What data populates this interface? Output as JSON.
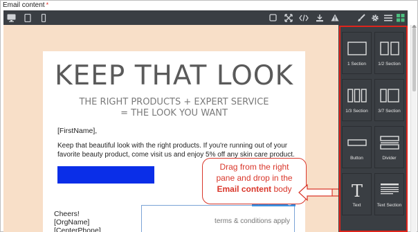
{
  "field": {
    "label": "Email content",
    "required_mark": "*"
  },
  "toolbar": {
    "left_icons": [
      "desktop-icon",
      "tablet-icon",
      "mobile-icon"
    ],
    "right_icons": [
      "square-icon",
      "fullscreen-icon",
      "code-icon",
      "download-icon",
      "warning-icon",
      "brush-icon",
      "gear-icon",
      "menu-icon",
      "blocks-icon"
    ],
    "active_icon": "blocks-icon",
    "accent_color": "#4cbf7f"
  },
  "email": {
    "headline": "KEEP THAT LOOK",
    "subhead_line1": "THE RIGHT PRODUCTS + EXPERT SERVICE",
    "subhead_line2": "= THE LOOK YOU WANT",
    "firstname": "[FirstName],",
    "body": "Keep that beautiful look with the right products. If you're running out of your favorite beauty product, come visit us and enjoy 5% off any skin care product.",
    "cta_color": "#0a2ee8",
    "signoff": [
      "Cheers!",
      "[OrgName]",
      "[CenterPhone]"
    ],
    "terms": "terms & conditions apply"
  },
  "callout": {
    "line1": "Drag from the right",
    "line2": "pane and drop in the",
    "bold": "Email content",
    "tail": " body"
  },
  "blocks": [
    {
      "label": "1 Section",
      "icon": "one-section-icon"
    },
    {
      "label": "1/2 Section",
      "icon": "half-section-icon"
    },
    {
      "label": "1/3 Section",
      "icon": "third-section-icon"
    },
    {
      "label": "3/7 Section",
      "icon": "three-seven-section-icon"
    },
    {
      "label": "Button",
      "icon": "button-block-icon"
    },
    {
      "label": "Divider",
      "icon": "divider-block-icon"
    },
    {
      "label": "Text",
      "icon": "text-block-icon"
    },
    {
      "label": "Text Section",
      "icon": "text-section-icon"
    }
  ]
}
